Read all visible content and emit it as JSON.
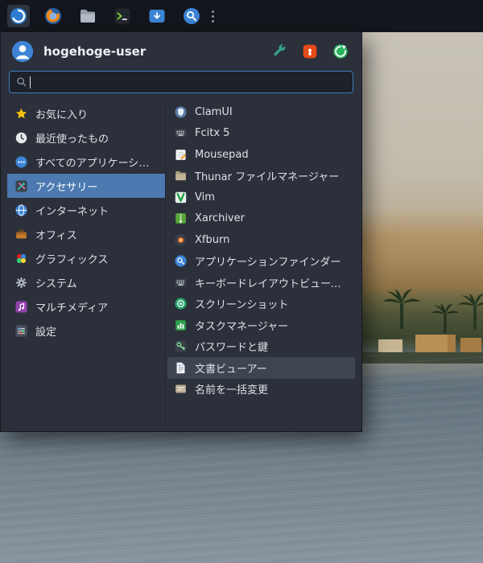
{
  "panel": {
    "launchers": [
      {
        "icon": "whisker-menu-icon",
        "active": true
      },
      {
        "icon": "web-browser-icon"
      },
      {
        "icon": "file-manager-icon"
      },
      {
        "icon": "terminal-icon"
      },
      {
        "icon": "software-icon"
      },
      {
        "icon": "app-finder-icon"
      }
    ],
    "handle_icon": "panel-handle-dots"
  },
  "menu": {
    "username": "hogehoge-user",
    "header_actions": [
      {
        "icon": "settings-wrench-icon"
      },
      {
        "icon": "lock-screen-icon"
      },
      {
        "icon": "logout-icon"
      }
    ],
    "search": {
      "value": "",
      "placeholder": ""
    },
    "categories": [
      {
        "label": "お気に入り",
        "icon": "star-icon"
      },
      {
        "label": "最近使ったもの",
        "icon": "clock-icon"
      },
      {
        "label": "すべてのアプリケーション",
        "icon": "all-apps-dots-icon"
      },
      {
        "label": "アクセサリー",
        "icon": "tools-icon",
        "selected": true
      },
      {
        "label": "インターネット",
        "icon": "globe-icon"
      },
      {
        "label": "オフィス",
        "icon": "briefcase-icon"
      },
      {
        "label": "グラフィックス",
        "icon": "graphics-icon"
      },
      {
        "label": "システム",
        "icon": "gear-icon"
      },
      {
        "label": "マルチメディア",
        "icon": "music-note-icon"
      },
      {
        "label": "設定",
        "icon": "sliders-icon"
      }
    ],
    "apps": [
      {
        "label": "ClamUI",
        "icon": "shield-icon"
      },
      {
        "label": "Fcitx 5",
        "icon": "keyboard-icon"
      },
      {
        "label": "Mousepad",
        "icon": "notepad-pencil-icon"
      },
      {
        "label": "Thunar  ファイルマネージャー",
        "icon": "folder-icon"
      },
      {
        "label": "Vim",
        "icon": "vim-icon"
      },
      {
        "label": "Xarchiver",
        "icon": "archive-icon"
      },
      {
        "label": "Xfburn",
        "icon": "disc-burn-icon"
      },
      {
        "label": "アプリケーションファインダー",
        "icon": "magnifier-icon"
      },
      {
        "label": "キーボードレイアウトビューアー",
        "icon": "keyboard-icon"
      },
      {
        "label": "スクリーンショット",
        "icon": "camera-shutter-icon"
      },
      {
        "label": "タスクマネージャー",
        "icon": "chart-bars-icon"
      },
      {
        "label": "パスワードと鍵",
        "icon": "key-icon"
      },
      {
        "label": "文書ビューアー",
        "icon": "document-icon",
        "highlighted": true
      },
      {
        "label": "名前を一括変更",
        "icon": "rename-icon"
      }
    ]
  },
  "colors": {
    "accent_selection": "#4b79b0",
    "hover_row": "#3e4450",
    "search_border": "#3f7cc0",
    "panel_bg": "#13161c",
    "menu_bg": "#2b303a",
    "star": "#f5c211",
    "lock": "#e64a19",
    "logout_green": "#2ab35f"
  }
}
